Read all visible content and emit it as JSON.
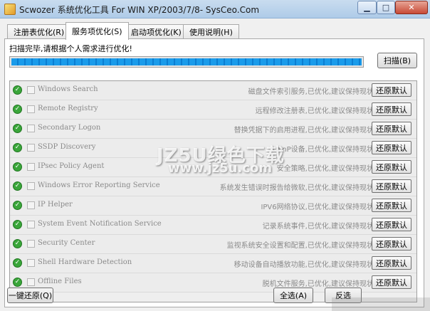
{
  "window": {
    "title": "Scwozer 系统优化工具 For WIN XP/2003/7/8- SysCeo.Com",
    "minimize": "▁",
    "maximize": "□",
    "close": "✕"
  },
  "tabs": [
    {
      "label": "注册表优化(R)",
      "active": false
    },
    {
      "label": "服务项优化(S)",
      "active": true
    },
    {
      "label": "启动项优化(K)",
      "active": false
    },
    {
      "label": "使用说明(H)",
      "active": false
    }
  ],
  "status": {
    "message": "扫描完毕,请根据个人需求进行优化!",
    "progress_percent": 100
  },
  "scan_button": "扫描(B)",
  "services": [
    {
      "name": "Windows Search",
      "desc": "磁盘文件索引服务,已优化,建议保持现状",
      "action": "还原默认"
    },
    {
      "name": "Remote Registry",
      "desc": "远程修改注册表,已优化,建议保持现状",
      "action": "还原默认"
    },
    {
      "name": "Secondary Logon",
      "desc": "替换凭据下的启用进程,已优化,建议保持现状",
      "action": "还原默认"
    },
    {
      "name": "SSDP Discovery",
      "desc": "UPnP设备,已优化,建议保持现状",
      "action": "还原默认"
    },
    {
      "name": "IPsec Policy Agent",
      "desc": "安全策略,已优化,建议保持现状",
      "action": "还原默认"
    },
    {
      "name": "Windows Error Reporting Service",
      "desc": "系统发生错误时报告给微软,已优化,建议保持现状",
      "action": "还原默认"
    },
    {
      "name": "IP Helper",
      "desc": "IPV6网络协议,已优化,建议保持现状",
      "action": "还原默认"
    },
    {
      "name": "System Event Notification Service",
      "desc": "记录系统事件,已优化,建议保持现状",
      "action": "还原默认"
    },
    {
      "name": "Security Center",
      "desc": "监视系统安全设置和配置,已优化,建议保持现状",
      "action": "还原默认"
    },
    {
      "name": "Shell Hardware Detection",
      "desc": "移动设备自动播放功能,已优化,建议保持现状",
      "action": "还原默认"
    },
    {
      "name": "Offline Files",
      "desc": "脱机文件服务,已优化,建议保持现状",
      "action": "还原默认"
    }
  ],
  "bottom": {
    "restore_all": "一键还原(Q)",
    "select_all": "全选(A)",
    "invert": "反选"
  },
  "watermark": {
    "main": "JZ5U绿色下载",
    "url": "www.jz5u.com"
  }
}
